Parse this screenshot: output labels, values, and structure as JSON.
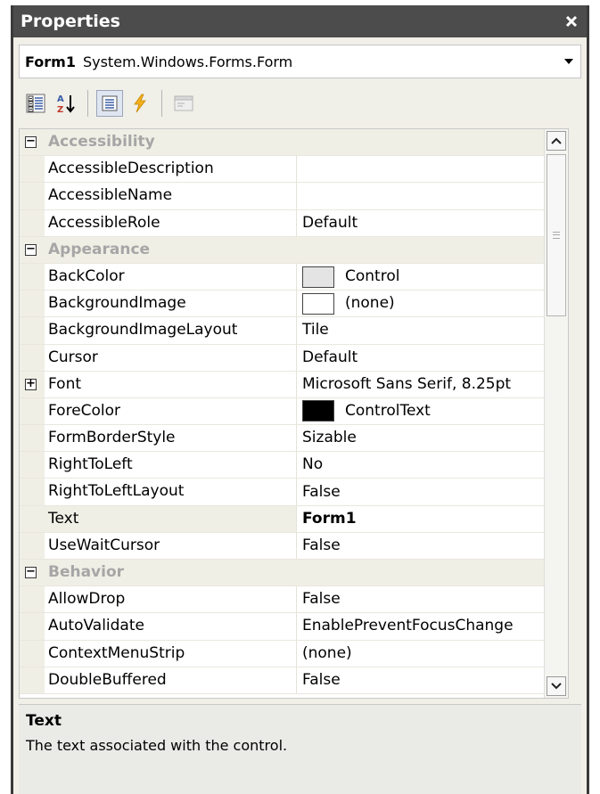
{
  "window": {
    "title": "Properties",
    "close_glyph": "✕"
  },
  "object_selector": {
    "name": "Form1",
    "type": "System.Windows.Forms.Form"
  },
  "toolbar": {
    "buttons": [
      {
        "icon": "categorized-icon"
      },
      {
        "icon": "alphabetical-sort-icon"
      },
      {
        "icon": "properties-icon"
      },
      {
        "icon": "events-lightning-icon"
      },
      {
        "icon": "property-pages-icon"
      }
    ]
  },
  "grid": {
    "rows": [
      {
        "kind": "category",
        "name": "Accessibility",
        "expanded": true
      },
      {
        "kind": "property",
        "name": "AccessibleDescription",
        "value": ""
      },
      {
        "kind": "property",
        "name": "AccessibleName",
        "value": ""
      },
      {
        "kind": "property",
        "name": "AccessibleRole",
        "value": "Default"
      },
      {
        "kind": "category",
        "name": "Appearance",
        "expanded": true
      },
      {
        "kind": "property",
        "name": "BackColor",
        "value": "Control",
        "swatch": "#e4e4e4"
      },
      {
        "kind": "property",
        "name": "BackgroundImage",
        "value": "(none)",
        "swatch": "#ffffff"
      },
      {
        "kind": "property",
        "name": "BackgroundImageLayout",
        "value": "Tile"
      },
      {
        "kind": "property",
        "name": "Cursor",
        "value": "Default"
      },
      {
        "kind": "property",
        "name": "Font",
        "value": "Microsoft Sans Serif, 8.25pt",
        "expandable": true
      },
      {
        "kind": "property",
        "name": "ForeColor",
        "value": "ControlText",
        "swatch": "#000000"
      },
      {
        "kind": "property",
        "name": "FormBorderStyle",
        "value": "Sizable"
      },
      {
        "kind": "property",
        "name": "RightToLeft",
        "value": "No"
      },
      {
        "kind": "property",
        "name": "RightToLeftLayout",
        "value": "False"
      },
      {
        "kind": "property",
        "name": "Text",
        "value": "Form1",
        "selected": true
      },
      {
        "kind": "property",
        "name": "UseWaitCursor",
        "value": "False"
      },
      {
        "kind": "category",
        "name": "Behavior",
        "expanded": true
      },
      {
        "kind": "property",
        "name": "AllowDrop",
        "value": "False"
      },
      {
        "kind": "property",
        "name": "AutoValidate",
        "value": "EnablePreventFocusChange"
      },
      {
        "kind": "property",
        "name": "ContextMenuStrip",
        "value": "(none)"
      },
      {
        "kind": "property",
        "name": "DoubleBuffered",
        "value": "False"
      }
    ],
    "scroll_position": 0.0
  },
  "description": {
    "title": "Text",
    "text": "The text associated with the control."
  },
  "colors": {
    "titlebar": "#4c4c4c",
    "category_text": "#a6a6a6",
    "category_bg": "#f0efe6"
  }
}
